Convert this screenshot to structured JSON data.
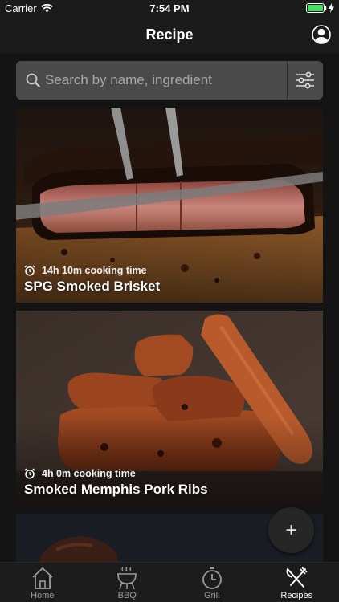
{
  "status_bar": {
    "carrier": "Carrier",
    "time": "7:54 PM",
    "battery_color": "#4cd964"
  },
  "nav": {
    "title": "Recipe"
  },
  "search": {
    "placeholder": "Search by name, ingredient"
  },
  "recipes": [
    {
      "name": "SPG Smoked Brisket",
      "cooking_time": "14h 10m cooking time"
    },
    {
      "name": "Smoked Memphis Pork Ribs",
      "cooking_time": "4h 0m cooking time"
    }
  ],
  "fab": {
    "label": "+"
  },
  "tabs": [
    {
      "label": "Home",
      "icon": "home-icon"
    },
    {
      "label": "BBQ",
      "icon": "bbq-grill-icon"
    },
    {
      "label": "Grill",
      "icon": "timer-icon"
    },
    {
      "label": "Recipes",
      "icon": "fork-knife-icon",
      "active": true
    }
  ]
}
